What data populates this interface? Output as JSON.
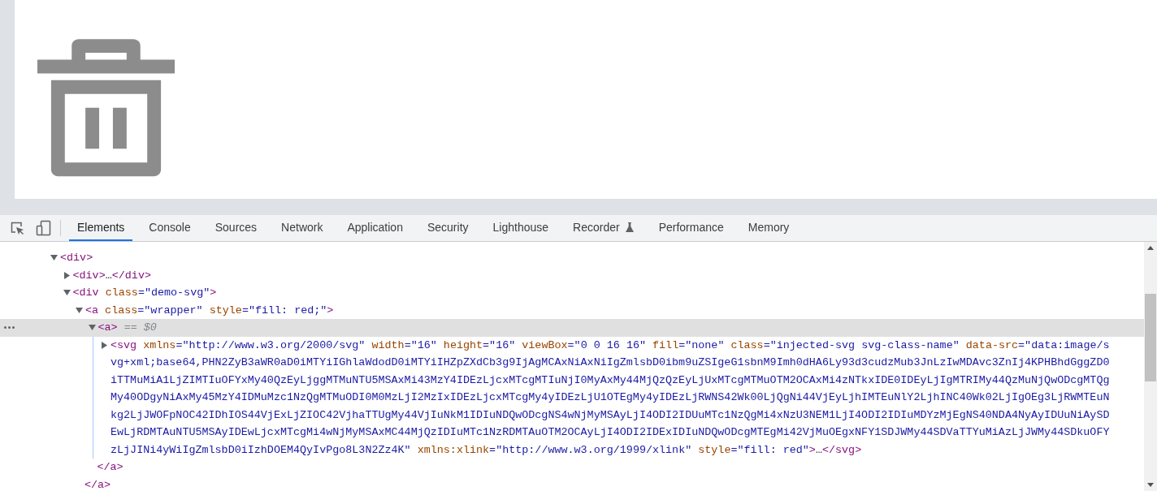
{
  "devtools": {
    "tabs": [
      {
        "label": "Elements",
        "selected": true,
        "kind": "plain"
      },
      {
        "label": "Console",
        "selected": false,
        "kind": "plain"
      },
      {
        "label": "Sources",
        "selected": false,
        "kind": "plain"
      },
      {
        "label": "Network",
        "selected": false,
        "kind": "plain"
      },
      {
        "label": "Application",
        "selected": false,
        "kind": "plain"
      },
      {
        "label": "Security",
        "selected": false,
        "kind": "plain"
      },
      {
        "label": "Lighthouse",
        "selected": false,
        "kind": "plain"
      },
      {
        "label": "Recorder",
        "selected": false,
        "kind": "experimental"
      },
      {
        "label": "Performance",
        "selected": false,
        "kind": "plain"
      },
      {
        "label": "Memory",
        "selected": false,
        "kind": "plain"
      }
    ],
    "dom_tree": [
      {
        "open": [
          {
            "tag": "<div>"
          }
        ],
        "expanded": true,
        "selected": false,
        "children": [
          {
            "open": [
              {
                "tag": "<div>"
              },
              {
                "text": "…"
              },
              {
                "tag": "</div>"
              }
            ],
            "expanded": false,
            "selected": false
          },
          {
            "open": [
              {
                "tag": "<div"
              },
              {
                "attr_name": " class"
              },
              {
                "attr_value": "=\"demo-svg\""
              },
              {
                "tag": ">"
              }
            ],
            "expanded": true,
            "selected": false,
            "children": [
              {
                "open": [
                  {
                    "tag": "<a"
                  },
                  {
                    "attr_name": " class"
                  },
                  {
                    "attr_value": "=\"wrapper\""
                  },
                  {
                    "attr_name": " style"
                  },
                  {
                    "attr_value": "=\"fill: red;\""
                  },
                  {
                    "tag": ">"
                  }
                ],
                "expanded": true,
                "selected": false,
                "close": [
                  {
                    "tag": "</a>"
                  }
                ],
                "children": [
                  {
                    "open": [
                      {
                        "tag": "<a>"
                      },
                      {
                        "note": " == $0"
                      }
                    ],
                    "expanded": true,
                    "selected": true,
                    "close": [
                      {
                        "tag": "</a>"
                      }
                    ],
                    "children": [
                      {
                        "open": [
                          {
                            "tag": "<svg"
                          },
                          {
                            "attr_name": " xmlns"
                          },
                          {
                            "attr_value": "=\"http://www.w3.org/2000/svg\""
                          },
                          {
                            "attr_name": " width"
                          },
                          {
                            "attr_value": "=\"16\""
                          },
                          {
                            "attr_name": " height"
                          },
                          {
                            "attr_value": "=\"16\""
                          },
                          {
                            "attr_name": " viewBox"
                          },
                          {
                            "attr_value": "=\"0 0 16 16\""
                          },
                          {
                            "attr_name": " fill"
                          },
                          {
                            "attr_value": "=\"none\""
                          },
                          {
                            "attr_name": " class"
                          },
                          {
                            "attr_value": "=\"injected-svg svg-class-name\""
                          },
                          {
                            "attr_name": " data-src"
                          },
                          {
                            "attr_value": "=\"data:image/svg+xml;base64,PHN2ZyB3aWR0aD0iMTYiIGhlaWdodD0iMTYiIHZpZXdCb3g9IjAgMCAxNiAxNiIgZmlsbD0ibm9uZSIgeG1sbnM9Imh0dHA6Ly93d3cudzMub3JnLzIwMDAvc3ZnIj4KPHBhdGggZD0iTTMuMiA1LjZIMTIuOFYxMy40QzEyLjggMTMuNTU5MSAxMi43MzY4IDEzLjcxMTcgMTIuNjI0MyAxMy44MjQzQzEyLjUxMTcgMTMuOTM2OCAxMi4zNTkxIDE0IDEyLjIgMTRIMy44QzMuNjQwODcgMTQgMy40ODgyNiAxMy45MzY4IDMuMzc1NzQgMTMuODI0M0MzLjI2MzIxIDEzLjcxMTcgMy4yIDEzLjU1OTEgMy4yIDEzLjRWNS42Wk00LjQgNi44VjEyLjhIMTEuNlY2LjhINC40Wk02LjIgOEg3LjRWMTEuNkg2LjJWOFpNOC42IDhIOS44VjExLjZIOC42VjhaTTUgMy44VjIuNkM1IDIuNDQwODcgNS4wNjMyMSAyLjI4ODI2IDUuMTc1NzQgMi4xNzU3NEM1LjI4ODI2IDIuMDYzMjEgNS40NDA4NyAyIDUuNiAySDEwLjRDMTAuNTU5MSAyIDEwLjcxMTcgMi4wNjMyMSAxMC44MjQzIDIuMTc1NzRDMTAuOTM2OCAyLjI4ODI2IDExIDIuNDQwODcgMTEgMi42VjMuOEgxNFY1SDJWMy44SDVaTTYuMiAzLjJWMy44SDkuOFYzLjJINi4yWiIgZmlsbD0iIzhDOEM4QyIvPgo8L3N2Zz4K\""
                          },
                          {
                            "attr_name": " xmlns:xlink"
                          },
                          {
                            "attr_value": "=\"http://www.w3.org/1999/xlink\""
                          },
                          {
                            "attr_name": " style"
                          },
                          {
                            "attr_value": "=\"fill: red\""
                          },
                          {
                            "tag": ">"
                          },
                          {
                            "text": "…"
                          },
                          {
                            "tag": "</svg>"
                          }
                        ],
                        "expanded": false,
                        "selected": false
                      }
                    ]
                  }
                ]
              }
            ]
          }
        ]
      }
    ]
  }
}
